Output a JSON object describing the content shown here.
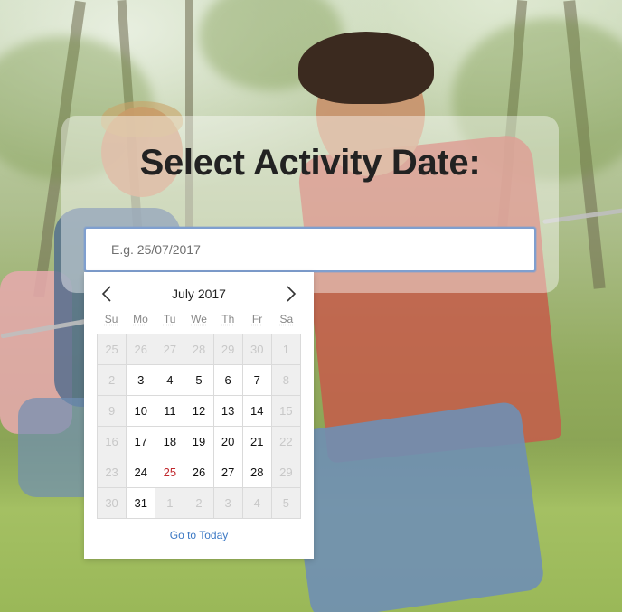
{
  "page": {
    "title": "Select Activity Date:",
    "accent_color": "#3b78c4",
    "today_color": "#c0282d"
  },
  "date_input": {
    "placeholder": "E.g. 25/07/2017",
    "value": ""
  },
  "calendar": {
    "month_label": "July 2017",
    "prev_icon": "chevron-left-icon",
    "next_icon": "chevron-right-icon",
    "weekdays": [
      "Su",
      "Mo",
      "Tu",
      "We",
      "Th",
      "Fr",
      "Sa"
    ],
    "weeks": [
      [
        {
          "d": "25",
          "m": true
        },
        {
          "d": "26",
          "m": true
        },
        {
          "d": "27",
          "m": true
        },
        {
          "d": "28",
          "m": true
        },
        {
          "d": "29",
          "m": true
        },
        {
          "d": "30",
          "m": true
        },
        {
          "d": "1",
          "m": true
        }
      ],
      [
        {
          "d": "2",
          "m": true
        },
        {
          "d": "3"
        },
        {
          "d": "4"
        },
        {
          "d": "5"
        },
        {
          "d": "6"
        },
        {
          "d": "7"
        },
        {
          "d": "8",
          "m": true
        }
      ],
      [
        {
          "d": "9",
          "m": true
        },
        {
          "d": "10"
        },
        {
          "d": "11"
        },
        {
          "d": "12"
        },
        {
          "d": "13"
        },
        {
          "d": "14"
        },
        {
          "d": "15",
          "m": true
        }
      ],
      [
        {
          "d": "16",
          "m": true
        },
        {
          "d": "17"
        },
        {
          "d": "18"
        },
        {
          "d": "19"
        },
        {
          "d": "20"
        },
        {
          "d": "21"
        },
        {
          "d": "22",
          "m": true
        }
      ],
      [
        {
          "d": "23",
          "m": true
        },
        {
          "d": "24"
        },
        {
          "d": "25",
          "today": true
        },
        {
          "d": "26"
        },
        {
          "d": "27"
        },
        {
          "d": "28"
        },
        {
          "d": "29",
          "m": true
        }
      ],
      [
        {
          "d": "30",
          "m": true
        },
        {
          "d": "31"
        },
        {
          "d": "1",
          "m": true
        },
        {
          "d": "2",
          "m": true
        },
        {
          "d": "3",
          "m": true
        },
        {
          "d": "4",
          "m": true
        },
        {
          "d": "5",
          "m": true
        }
      ]
    ],
    "goto_today_label": "Go to Today"
  }
}
